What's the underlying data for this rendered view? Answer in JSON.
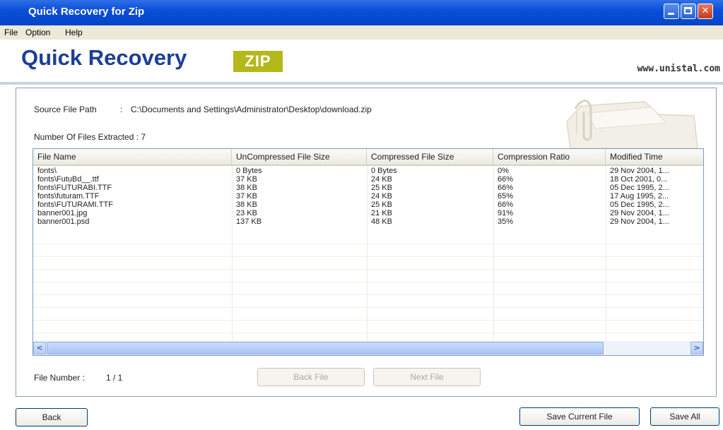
{
  "window": {
    "title": "Quick Recovery for Zip"
  },
  "menu": [
    "File",
    "Option",
    "Help"
  ],
  "header": {
    "brand": "Quick Recovery",
    "tag": "ZIP",
    "website": "www.unistal.com"
  },
  "source": {
    "label": "Source File Path",
    "separator": ":",
    "path": "C:\\Documents and Settings\\Administrator\\Desktop\\download.zip"
  },
  "extracted": {
    "label": "Number Of Files Extracted : 7"
  },
  "table": {
    "columns": [
      "File Name",
      "UnCompressed File Size",
      "Compressed File Size",
      "Compression Ratio",
      "Modified Time"
    ],
    "rows": [
      [
        "fonts\\",
        "0  Bytes",
        "0  Bytes",
        "0%",
        "29 Nov 2004, 1..."
      ],
      [
        "fonts\\FutuBd__.ttf",
        "37  KB",
        "24  KB",
        "66%",
        "18 Oct 2001, 0..."
      ],
      [
        "fonts\\FUTURABI.TTF",
        "38  KB",
        "25  KB",
        "66%",
        "05 Dec 1995, 2..."
      ],
      [
        "fonts\\futuram.TTF",
        "37  KB",
        "24  KB",
        "65%",
        "17 Aug 1995, 2..."
      ],
      [
        "fonts\\FUTURAMI.TTF",
        "38  KB",
        "25  KB",
        "66%",
        "05 Dec 1995, 2..."
      ],
      [
        "banner001.jpg",
        "23  KB",
        "21  KB",
        "91%",
        "29 Nov 2004, 1..."
      ],
      [
        "banner001.psd",
        "137  KB",
        "48  KB",
        "35%",
        "29 Nov 2004, 1..."
      ]
    ]
  },
  "file_number": {
    "label": "File Number :",
    "value": "1 / 1"
  },
  "buttons": {
    "back_file": "Back File",
    "next_file": "Next File",
    "back": "Back",
    "save_current": "Save Current File",
    "save_all": "Save All"
  },
  "icons": {
    "scroll_left": "scroll-left-icon",
    "scroll_right": "scroll-right-icon",
    "folder": "folder-zip-icon"
  }
}
